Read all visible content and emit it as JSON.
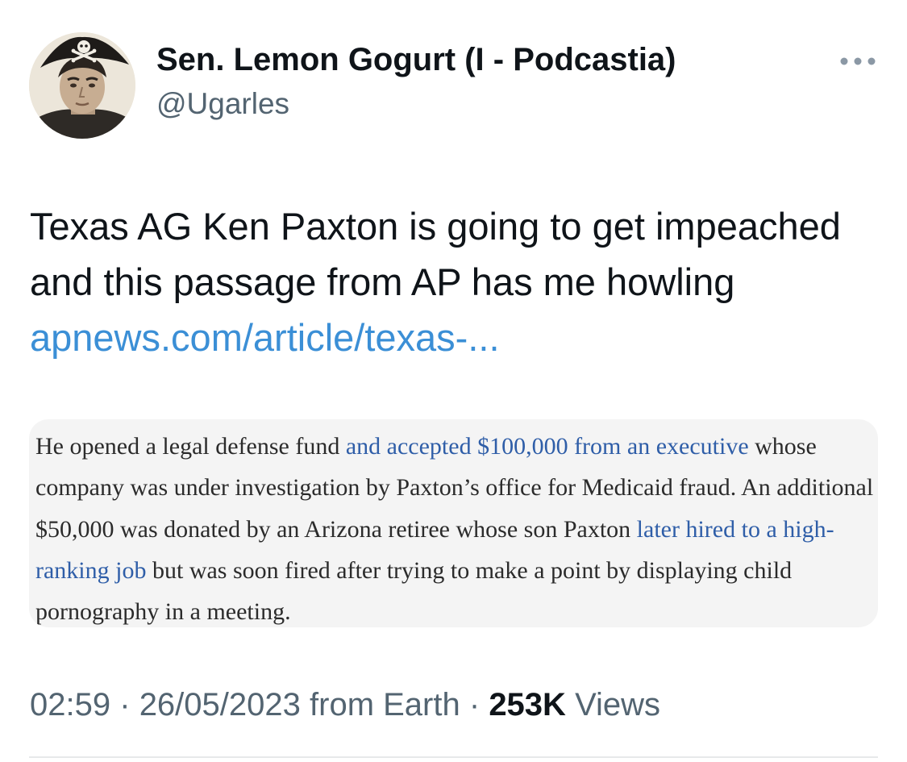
{
  "author": {
    "display_name": "Sen. Lemon Gogurt (I - Podcastia)",
    "handle": "@Ugarles",
    "avatar_icon": "profile-photo"
  },
  "more_icon": "more-horizontal-icon",
  "tweet": {
    "text_prefix": "Texas AG Ken Paxton is going to get impeached and this passage from AP has me howling",
    "link_text": "apnews.com/article/texas-..."
  },
  "quote_image": {
    "parts": [
      "He opened a legal defense fund ",
      "and accepted $100,000 from an executive",
      " whose company was under investigation by Paxton’s office for Medicaid fraud. An additional $50,000 was donated by an Arizona retiree whose son Paxton ",
      "later hired to a high-ranking job",
      " but was soon fired after trying to make a point by displaying child pornography in a meeting."
    ]
  },
  "meta": {
    "time": "02:59",
    "separator": "·",
    "date": "26/05/2023",
    "source": "from Earth",
    "views_count": "253K",
    "views_label": "Views"
  },
  "colors": {
    "link": "#3b8fd6",
    "secondary_text": "#536471",
    "quote_link": "#2f5ea8",
    "quote_background": "#f4f4f4"
  }
}
